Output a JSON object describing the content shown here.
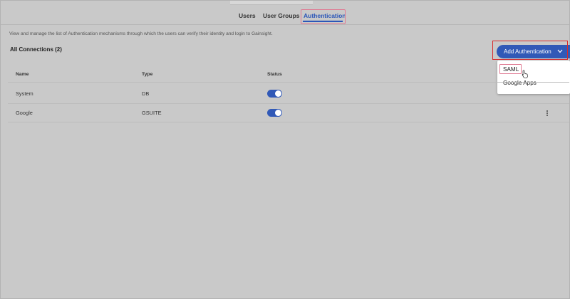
{
  "tabs": {
    "users": "Users",
    "user_groups": "User Groups",
    "authentication": "Authentication"
  },
  "description": "View and manage the list of Authentication mechanisms through which the users can verify their identity and login to Gainsight.",
  "connections": {
    "title": "All Connections (2)",
    "columns": {
      "name": "Name",
      "type": "Type",
      "status": "Status"
    },
    "rows": [
      {
        "name": "System",
        "type": "DB",
        "status_on": true
      },
      {
        "name": "Google",
        "type": "GSUITE",
        "status_on": true
      }
    ]
  },
  "add_button": {
    "label": "Add Authentication"
  },
  "dropdown": {
    "items": [
      "SAML",
      "Google Apps"
    ]
  },
  "colors": {
    "accent": "#3159b7",
    "highlight_pink": "#e07a93",
    "highlight_red": "#d92a2a",
    "overlay_bg": "#c9c9c9"
  }
}
